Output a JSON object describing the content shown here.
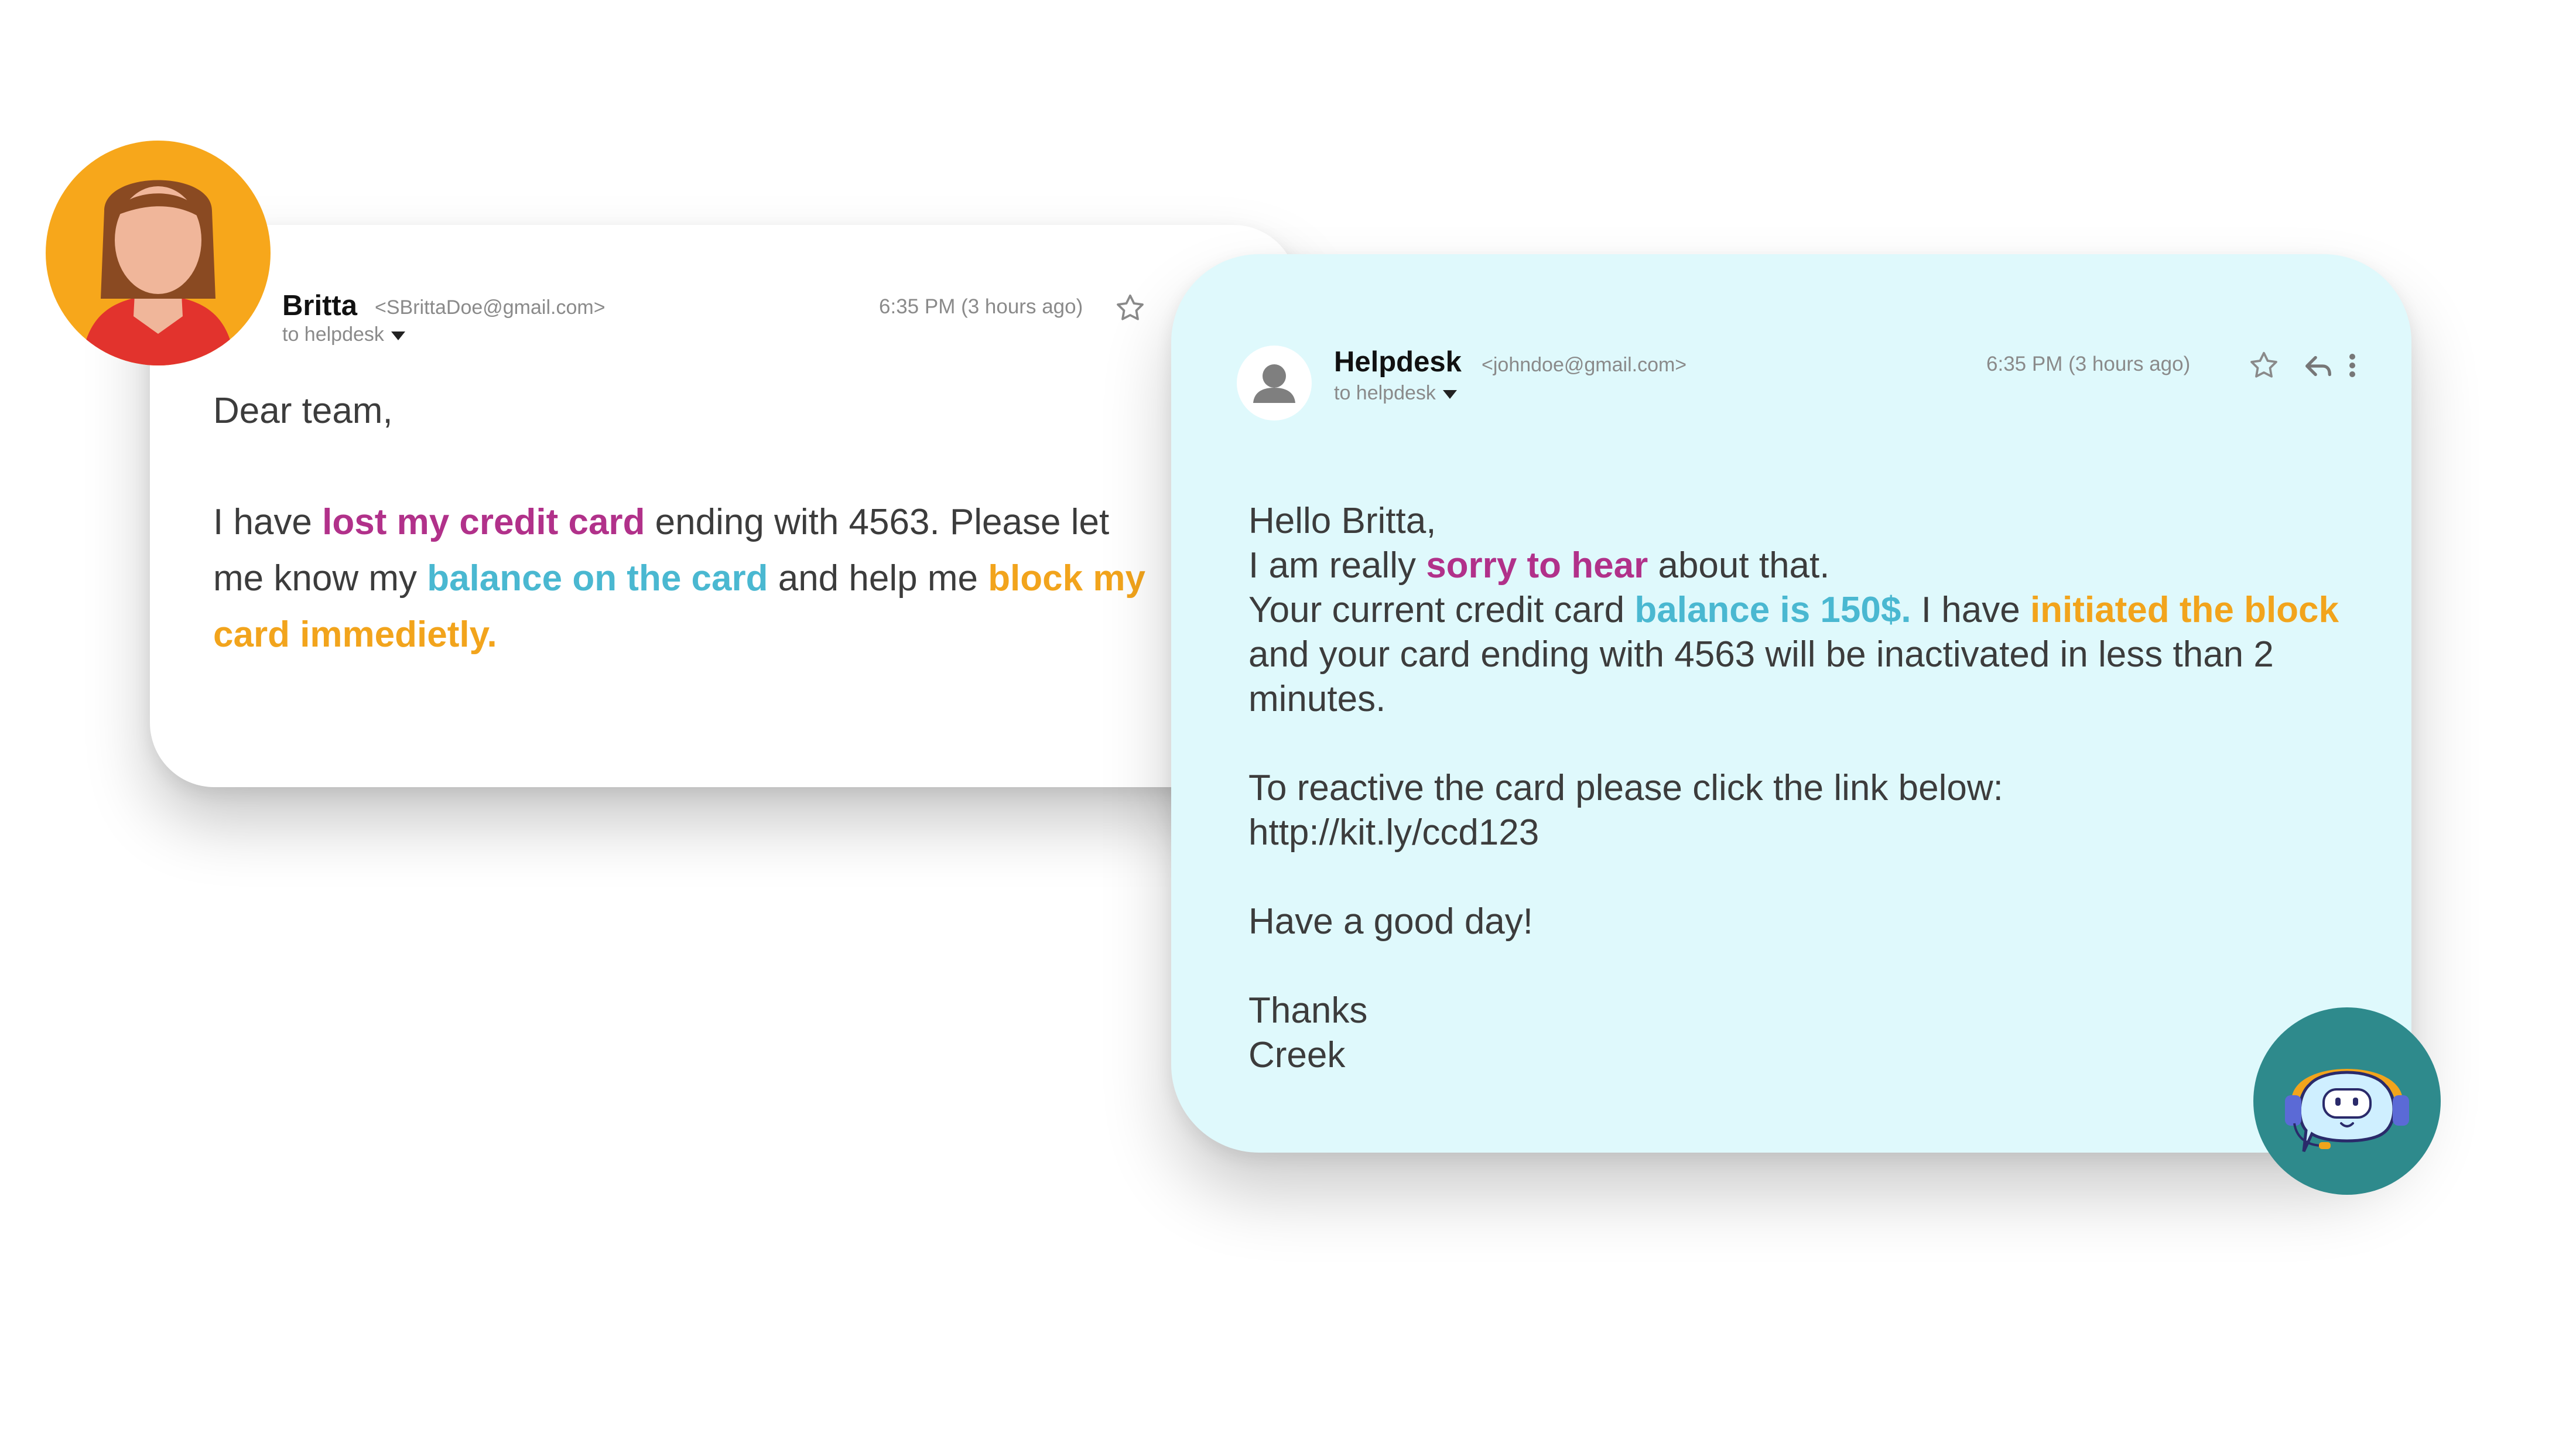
{
  "customer_email": {
    "sender_name": "Britta",
    "sender_email": "<SBrittaDoe@gmail.com>",
    "to_label": "to helpdesk",
    "time": "6:35 PM (3 hours ago)",
    "greeting": "Dear team,",
    "body": {
      "p1": "I have ",
      "h1": "lost my credit card",
      "p2": " ending with 4563. Please let me know my ",
      "h2": "balance on the card",
      "p3": " and help me ",
      "h3": "block my card immedietly."
    }
  },
  "helpdesk_email": {
    "sender_name": "Helpdesk",
    "sender_email": "<johndoe@gmail.com>",
    "to_label": "to helpdesk",
    "time": "6:35 PM (3 hours ago)",
    "line1": "Hello Britta,",
    "line2_a": "I am really ",
    "line2_h": "sorry to hear",
    "line2_b": " about that.",
    "line3_a": "Your current credit card ",
    "line3_h1": "balance is 150$.",
    "line3_b": " I have ",
    "line3_h2": "initiated the block",
    "line3_c": " and your card ending with 4563 will be inactivated in less than 2 minutes.",
    "line4": "To reactive the card please click the link below:",
    "link": "http://kit.ly/ccd123",
    "line5": "Have a good day!",
    "line6": "Thanks",
    "line7": "Creek"
  },
  "icons": {
    "star": "star-icon",
    "reply": "reply-icon",
    "more": "more-vertical-icon",
    "dropdown": "caret-down-icon"
  },
  "colors": {
    "helpdesk_card": "#dff9fc",
    "accent_purple": "#b1318a",
    "accent_blue": "#4ab8d1",
    "accent_orange": "#f2a41c",
    "customer_avatar_bg": "#f7a71b",
    "bot_avatar_bg": "#2e8a8c"
  }
}
